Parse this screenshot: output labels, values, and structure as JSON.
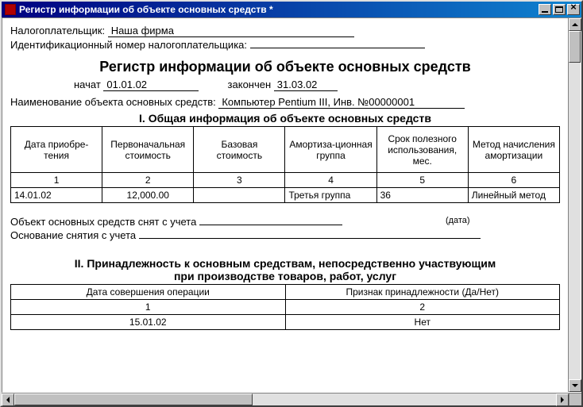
{
  "window": {
    "title": "Регистр информации об объекте основных средств   *"
  },
  "header": {
    "taxpayer_label": "Налогоплательщик:",
    "taxpayer_value": "Наша фирма",
    "inn_label": "Идентификационный номер налогоплательщика:",
    "inn_value": ""
  },
  "main_title": "Регистр информации об объекте основных средств",
  "period": {
    "start_label": "начат",
    "start_value": "01.01.02",
    "end_label": "закончен",
    "end_value": "31.03.02"
  },
  "object": {
    "label": "Наименование объекта основных средств:",
    "value": "Компьютер Pentium III, Инв. №00000001"
  },
  "section1": {
    "title": "I. Общая информация об объекте основных средств",
    "headers": [
      "Дата приобре-тения",
      "Первоначальная стоимость",
      "Базовая стоимость",
      "Амортиза-ционная группа",
      "Срок полезного использования, мес.",
      "Метод начисления амортизации"
    ],
    "numrow": [
      "1",
      "2",
      "3",
      "4",
      "5",
      "6"
    ],
    "datarow": [
      "14.01.02",
      "12,000.00",
      "",
      "Третья группа",
      "36",
      "Линейный метод"
    ]
  },
  "dereg": {
    "label": "Объект основных средств снят с учета",
    "value": "",
    "date_hint": "(дата)",
    "reason_label": "Основание снятия с учета",
    "reason_value": ""
  },
  "section2": {
    "title_l1": "II. Принадлежность к основным средствам, непосредственно участвующим",
    "title_l2": "при производстве товаров, работ, услуг",
    "headers": [
      "Дата совершения операции",
      "Признак принадлежности (Да/Нет)"
    ],
    "numrow": [
      "1",
      "2"
    ],
    "datarow": [
      "15.01.02",
      "Нет"
    ]
  }
}
